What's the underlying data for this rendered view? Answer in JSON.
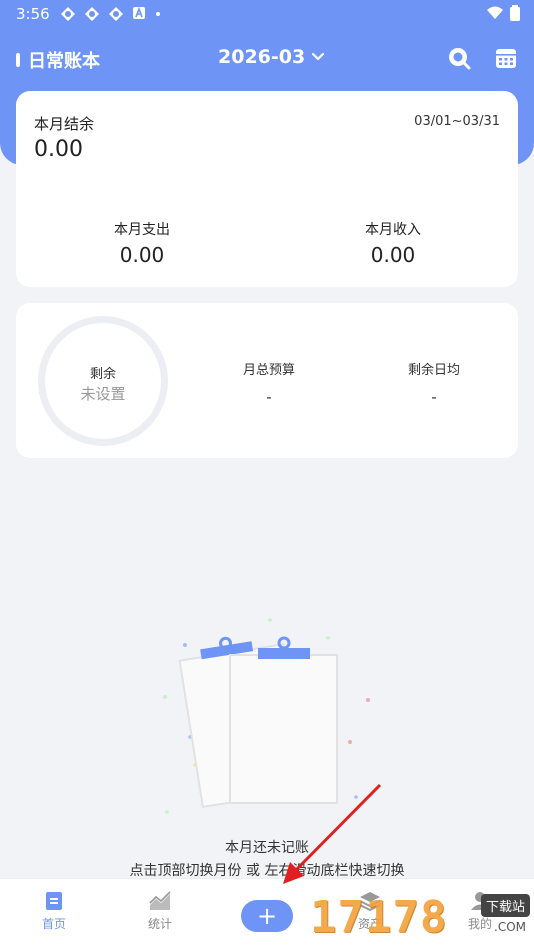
{
  "status_bar": {
    "time": "3:56"
  },
  "header": {
    "book_name": "日常账本",
    "month": "2026-03",
    "search_icon": "search-icon",
    "calendar_icon": "calendar-icon",
    "bg_color": "#6e94f5"
  },
  "summary": {
    "balance_label": "本月结余",
    "balance_value": "0.00",
    "date_range": "03/01~03/31",
    "expense_label": "本月支出",
    "expense_value": "0.00",
    "income_label": "本月收入",
    "income_value": "0.00"
  },
  "budget": {
    "ring_label": "剩余",
    "ring_value": "未设置",
    "total_label": "月总预算",
    "total_value": "-",
    "daily_label": "剩余日均",
    "daily_value": "-"
  },
  "empty": {
    "title": "本月还未记账",
    "hint": "点击顶部切换月份 或 左右滑动底栏快速切换"
  },
  "bottom_nav": {
    "home": "首页",
    "stats": "统计",
    "add": "+",
    "assets": "资产",
    "mine": "我的"
  },
  "watermark": {
    "text": "17178",
    "badge": "下载站",
    "sub": ".COM"
  }
}
